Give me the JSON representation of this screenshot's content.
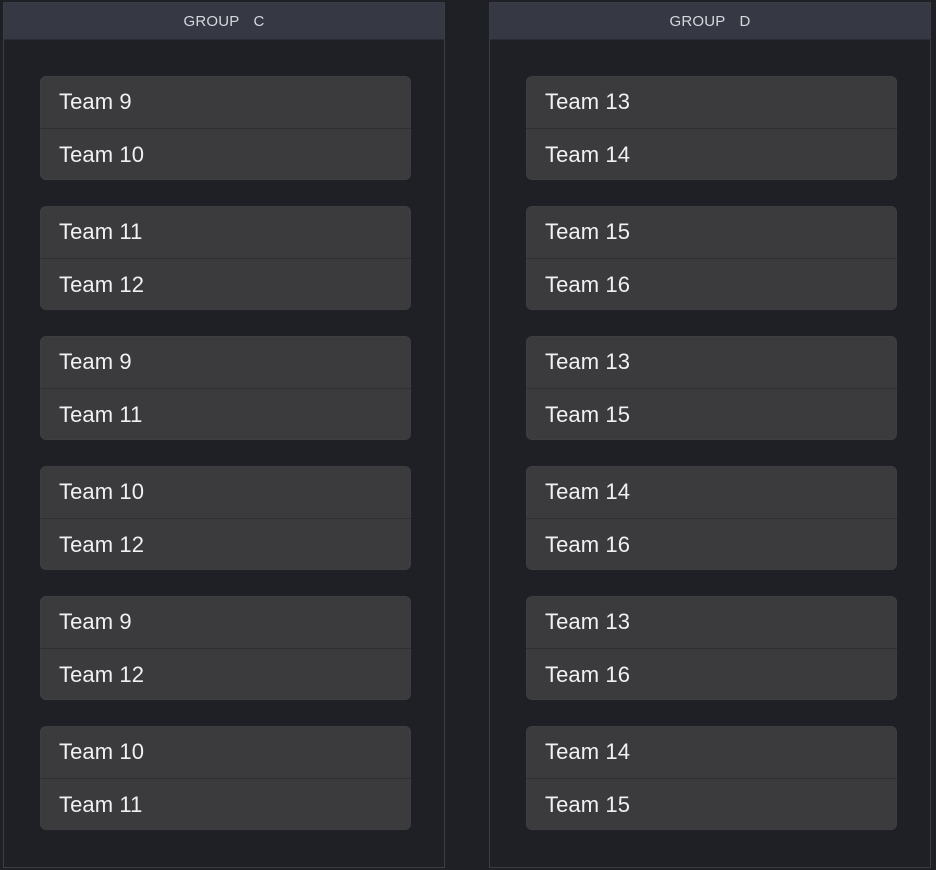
{
  "groups": [
    {
      "title": "GROUP",
      "letter": "C",
      "matches": [
        {
          "team_a": "Team 9",
          "team_b": "Team 10"
        },
        {
          "team_a": "Team 11",
          "team_b": "Team 12"
        },
        {
          "team_a": "Team 9",
          "team_b": "Team 11"
        },
        {
          "team_a": "Team 10",
          "team_b": "Team 12"
        },
        {
          "team_a": "Team 9",
          "team_b": "Team 12"
        },
        {
          "team_a": "Team 10",
          "team_b": "Team 11"
        }
      ]
    },
    {
      "title": "GROUP",
      "letter": "D",
      "matches": [
        {
          "team_a": "Team 13",
          "team_b": "Team 14"
        },
        {
          "team_a": "Team 15",
          "team_b": "Team 16"
        },
        {
          "team_a": "Team 13",
          "team_b": "Team 15"
        },
        {
          "team_a": "Team 14",
          "team_b": "Team 16"
        },
        {
          "team_a": "Team 13",
          "team_b": "Team 16"
        },
        {
          "team_a": "Team 14",
          "team_b": "Team 15"
        }
      ]
    }
  ],
  "colors": {
    "background": "#1f2026",
    "header": "#363944",
    "card": "#3b3b3d",
    "text": "#f1f1f3"
  }
}
